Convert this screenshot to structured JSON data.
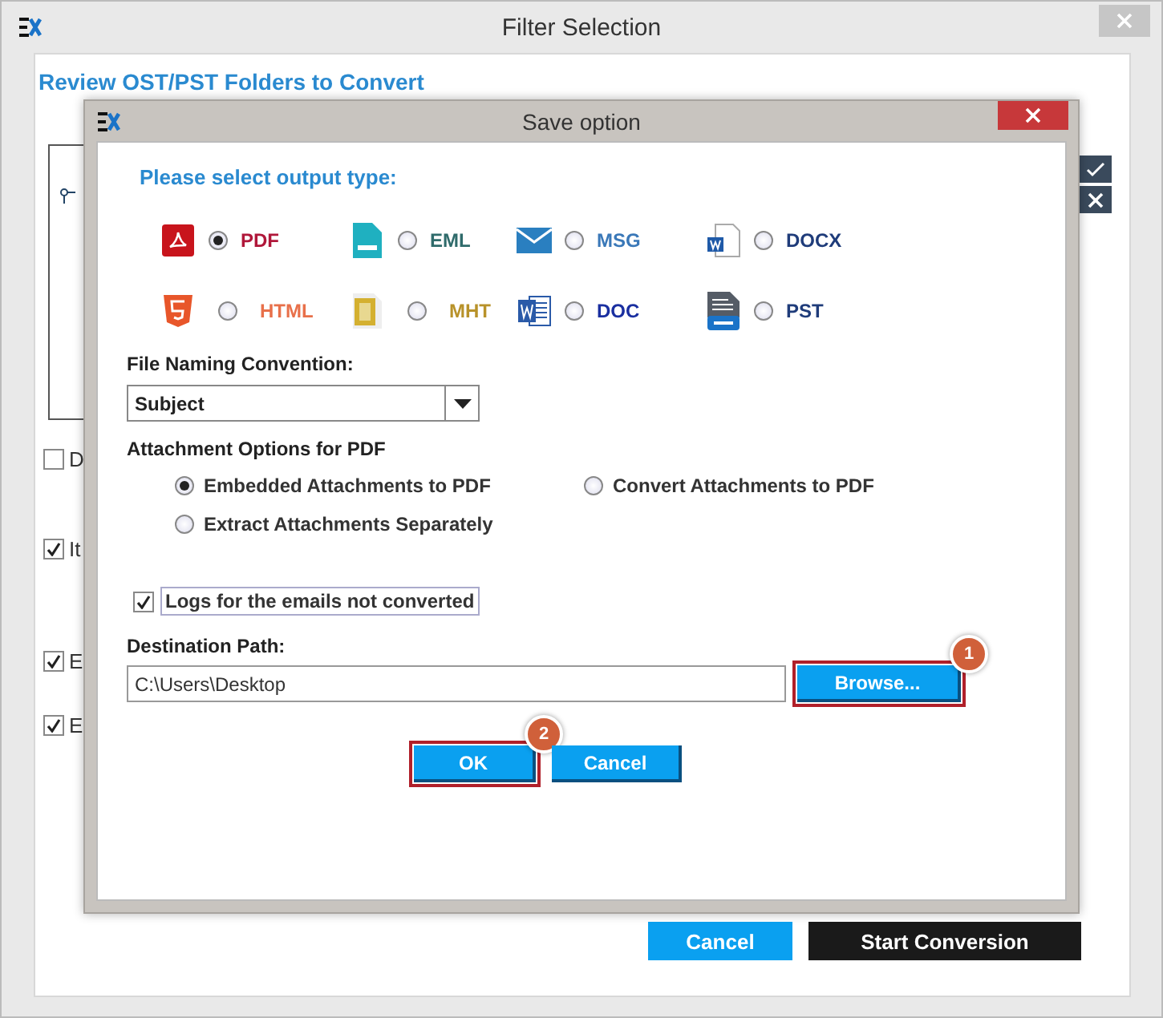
{
  "window": {
    "title": "Filter Selection"
  },
  "background": {
    "heading": "Review OST/PST Folders to Convert",
    "checkboxes": [
      {
        "label": "D",
        "checked": false
      },
      {
        "label": "It",
        "checked": true
      },
      {
        "label": "E",
        "checked": true
      },
      {
        "label": "E",
        "checked": true
      }
    ],
    "buttons": [
      {
        "label": "Cancel",
        "kind": "secondary"
      },
      {
        "label": "Start Conversion",
        "kind": "primary"
      }
    ]
  },
  "dialog": {
    "title": "Save option",
    "prompt": "Please select output type:",
    "formats": [
      {
        "label": "PDF",
        "kind": "pdf",
        "selected": true,
        "color": "#b0173a"
      },
      {
        "label": "EML",
        "kind": "eml",
        "selected": false,
        "color": "#2f6b6b"
      },
      {
        "label": "MSG",
        "kind": "msg",
        "selected": false,
        "color": "#3a78b8"
      },
      {
        "label": "DOCX",
        "kind": "docx",
        "selected": false,
        "color": "#1f3c7a"
      },
      {
        "label": "HTML",
        "kind": "html",
        "selected": false,
        "color": "#e8704a"
      },
      {
        "label": "MHT",
        "kind": "mht",
        "selected": false,
        "color": "#b8922a"
      },
      {
        "label": "DOC",
        "kind": "doc",
        "selected": false,
        "color": "#1a2fa0"
      },
      {
        "label": "PST",
        "kind": "pst",
        "selected": false,
        "color": "#1f3c7a"
      }
    ],
    "naming": {
      "label": "File Naming Convention:",
      "value": "Subject"
    },
    "attachments": {
      "label": "Attachment Options for PDF",
      "options": [
        {
          "label": "Embedded Attachments to PDF",
          "selected": true
        },
        {
          "label": "Convert Attachments to PDF",
          "selected": false
        },
        {
          "label": "Extract Attachments Separately",
          "selected": false
        }
      ]
    },
    "logs": {
      "label": "Logs for the emails not converted",
      "checked": true
    },
    "destination": {
      "label": "Destination Path:",
      "value": "C:\\Users\\Desktop",
      "browse": {
        "label": "Browse...",
        "highlighted": true,
        "step": "1"
      }
    },
    "buttons": [
      {
        "label": "OK",
        "highlighted": true,
        "step": "2"
      },
      {
        "label": "Cancel",
        "highlighted": false
      }
    ]
  }
}
